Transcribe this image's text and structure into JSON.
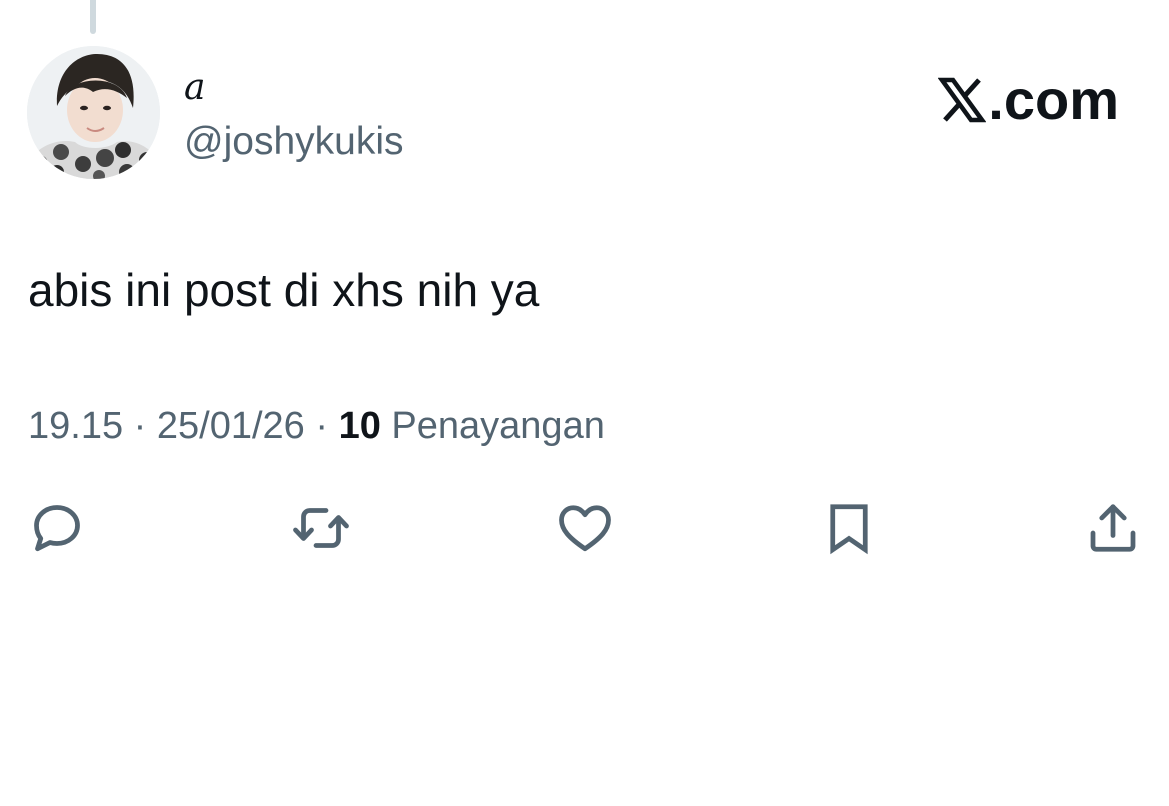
{
  "post": {
    "author": {
      "display_name": "𝑎",
      "handle": "@joshykukis",
      "avatar": "profile-photo"
    },
    "brand": {
      "label": ".com",
      "icon": "x-logo-icon"
    },
    "text": "abis ini post di xhs nih ya",
    "meta": {
      "time": "19.15",
      "separator": "·",
      "date": "25/01/26",
      "views_count": "10",
      "views_label": "Penayangan"
    },
    "actions": [
      {
        "name": "reply",
        "icon": "reply-icon"
      },
      {
        "name": "repost",
        "icon": "repost-icon"
      },
      {
        "name": "like",
        "icon": "heart-icon"
      },
      {
        "name": "bookmark",
        "icon": "bookmark-icon"
      },
      {
        "name": "share",
        "icon": "share-icon"
      }
    ]
  },
  "colors": {
    "text_primary": "#0f1419",
    "text_secondary": "#536471",
    "icon": "#536471",
    "thread_line": "#cfd9de"
  }
}
